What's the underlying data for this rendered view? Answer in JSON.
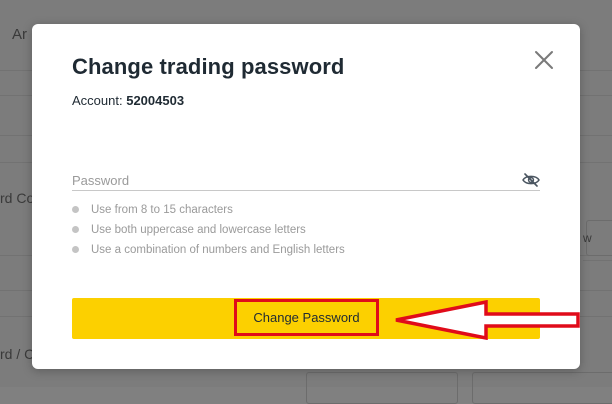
{
  "background": {
    "top_tab_text": "Ar",
    "left_label_1": "rd Co",
    "left_label_2": "rd / C",
    "right_label": "w"
  },
  "modal": {
    "title": "Change trading password",
    "account_label": "Account:",
    "account_number": "52004503",
    "password_placeholder": "Password",
    "password_value": "",
    "rules": [
      "Use from 8 to 15 characters",
      "Use both uppercase and lowercase letters",
      "Use a combination of numbers and English letters"
    ],
    "submit_label": "Change Password"
  },
  "colors": {
    "accent": "#fcd000",
    "highlight": "#e00b1a",
    "title": "#1f2a33"
  },
  "icons": {
    "close": "close-icon",
    "password_visibility": "eye-off-icon",
    "pointer": "arrow-left-icon"
  }
}
